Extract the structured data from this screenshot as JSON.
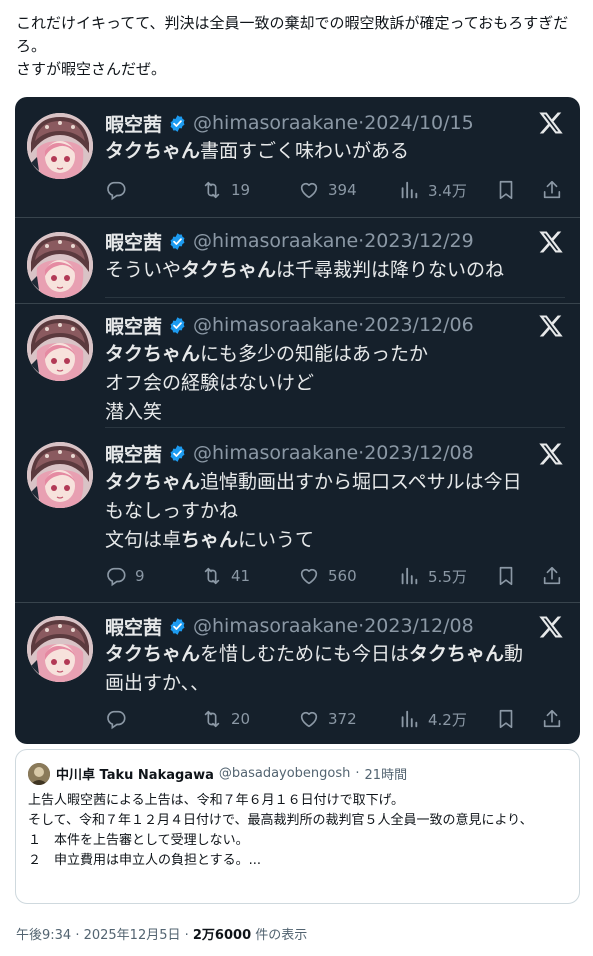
{
  "post": {
    "text": "これだけイキってて、判決は全員一致の棄却での暇空敗訴が確定っておもろすぎだろ。\nさすが暇空さんだぜ。"
  },
  "tweets": [
    {
      "name": "暇空茜",
      "handle": "@himasoraakane",
      "date": "2024/10/15",
      "bold1": "タクちゃん",
      "text1": "書面すごく味わいがある",
      "reply": "",
      "retweet": "19",
      "like": "394",
      "views": "3.4万"
    },
    {
      "name": "暇空茜",
      "handle": "@himasoraakane",
      "date": "2023/12/29",
      "pre": "そういや",
      "bold1": "タクちゃん",
      "text1": "は千尋裁判は降りないのね"
    },
    {
      "name": "暇空茜",
      "handle": "@himasoraakane",
      "date": "2023/12/06",
      "bold1": "タクちゃん",
      "text1": "にも多少の知能はあったか",
      "line2": "オフ会の経験はないけど",
      "line3": "潜入笑"
    },
    {
      "name": "暇空茜",
      "handle": "@himasoraakane",
      "date": "2023/12/08",
      "bold1": "タクちゃん",
      "text1": "追悼動画出すから堀口スペサルは今日",
      "line2": "もなしっすかね",
      "line3a": "文句は卓",
      "line3b": "ちゃん",
      "line3c": "にいうて",
      "reply": "9",
      "retweet": "41",
      "like": "560",
      "views": "5.5万"
    },
    {
      "name": "暇空茜",
      "handle": "@himasoraakane",
      "date": "2023/12/08",
      "bold1": "タクちゃん",
      "text1": "を惜しむためにも今日は",
      "bold2": "タクちゃん",
      "text2": "動",
      "line2": "画出すか、、",
      "reply": "",
      "retweet": "20",
      "like": "372",
      "views": "4.2万"
    }
  ],
  "quote": {
    "name": "中川卓 Taku Nakagawa",
    "handle": "@basadayobengosh",
    "dot": "·",
    "time": "21時間",
    "body": "上告人暇空茜による上告は、令和７年６月１６日付けで取下げ。\nそして、令和７年１２月４日付けで、最高裁判所の裁判官５人全員一致の意見により、\n１　本件を上告審として受理しない。\n２　申立費用は申立人の負担とする。..."
  },
  "meta": {
    "time": "午後9:34 · 2025年12月5日 · ",
    "views_count": "2万6000",
    "views_label": " 件の表示"
  },
  "colors": {
    "card_bg": "#15202b",
    "verified": "#1d9bf0",
    "muted": "#8b98a5"
  },
  "icons": [
    "verified-icon",
    "x-logo-icon",
    "reply-icon",
    "retweet-icon",
    "like-icon",
    "views-icon",
    "bookmark-icon",
    "share-icon"
  ]
}
